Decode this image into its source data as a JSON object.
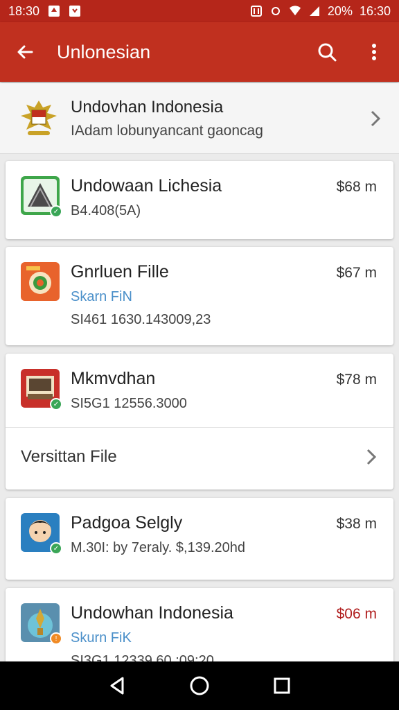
{
  "status_bar": {
    "left_time": "18:30",
    "battery": "20%",
    "clock": "16:30"
  },
  "app_bar": {
    "title": "Unlonesian"
  },
  "header": {
    "title": "Undovhan Indonesia",
    "subtitle": "IAdam lobunyancant gaoncag"
  },
  "items": [
    {
      "title": "Undowaan Lichesia",
      "sub": "B4.408(5A)",
      "size": "$68 m",
      "badge_color": "#3aa657"
    },
    {
      "title": "Gnrluen Fille",
      "link": "Skarn FiN",
      "sub": "SI461 1630.143009,23",
      "size": "$67 m"
    },
    {
      "title": "Mkmvdhan",
      "sub": "SI5G1 12556.3000",
      "size": "$78 m",
      "badge_color": "#3aa657"
    },
    {
      "title": "Padgoa Selgly",
      "sub": "M.30I: by 7eraly. $,139.20hd",
      "size": "$38 m",
      "badge_color": "#3aa657"
    },
    {
      "title": "Undowhan Indonesia",
      "link": "Skurn FiK",
      "sub": "SI3G1 12339.60.:09:20",
      "size": "$06 m",
      "badge_color": "#f08a24"
    }
  ],
  "version_row": {
    "label": "Versittan File"
  },
  "colors": {
    "primary": "#c0301f",
    "status_bar": "#b5261a",
    "link": "#4a8fc9"
  }
}
